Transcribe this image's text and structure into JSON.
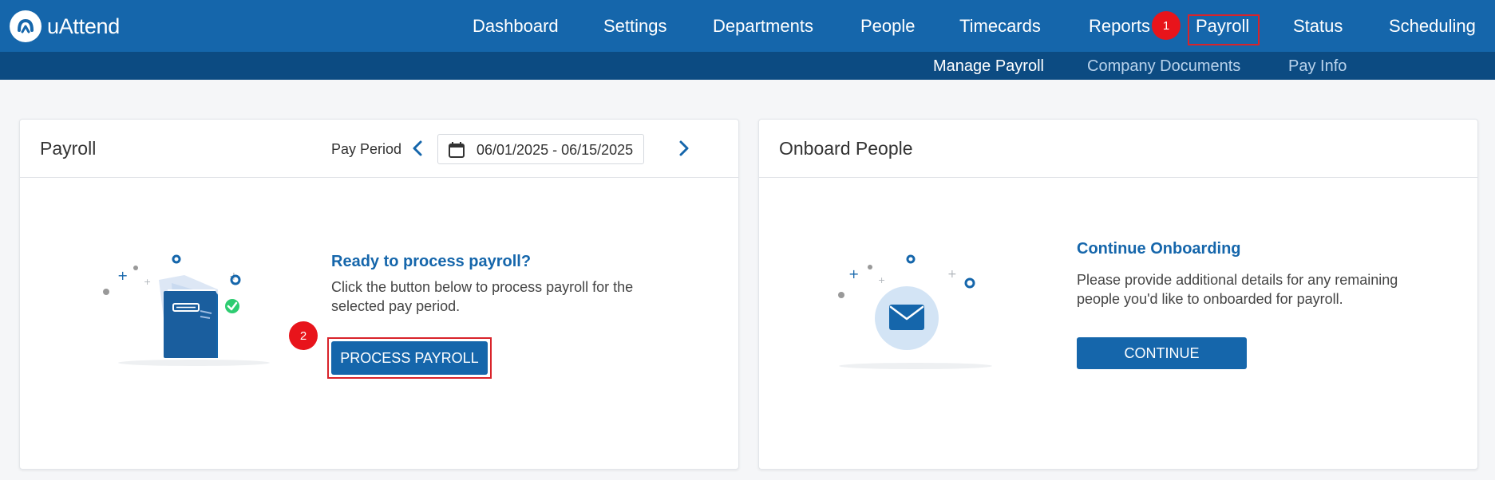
{
  "brand": {
    "name": "uAttend"
  },
  "nav": {
    "items": [
      "Dashboard",
      "Settings",
      "Departments",
      "People",
      "Timecards",
      "Reports",
      "Payroll",
      "Status",
      "Scheduling"
    ],
    "active": "Payroll"
  },
  "subnav": {
    "items": [
      "Manage Payroll",
      "Company Documents",
      "Pay Info"
    ],
    "active": "Manage Payroll"
  },
  "annotations": [
    "1",
    "2"
  ],
  "payroll_card": {
    "title": "Payroll",
    "pay_period_label": "Pay Period",
    "date_range": "06/01/2025 - 06/15/2025",
    "heading": "Ready to process payroll?",
    "description_line1": "Click the button below to process payroll for the",
    "description_line2": "selected pay period.",
    "button": "PROCESS PAYROLL"
  },
  "onboard_card": {
    "title": "Onboard People",
    "heading": "Continue Onboarding",
    "description_line1": "Please provide additional details for any remaining",
    "description_line2": "people you'd like to onboarded for payroll.",
    "button": "CONTINUE"
  },
  "colors": {
    "brand_blue": "#1566ab",
    "subnav_blue": "#0c4b82",
    "highlight_red": "#d9232a",
    "badge_red": "#e8141b",
    "success_green": "#2ecc71"
  },
  "icons": [
    "uattend-logo-icon",
    "chevron-left-icon",
    "calendar-icon",
    "chevron-right-icon",
    "payroll-document-illustration",
    "envelope-illustration"
  ]
}
